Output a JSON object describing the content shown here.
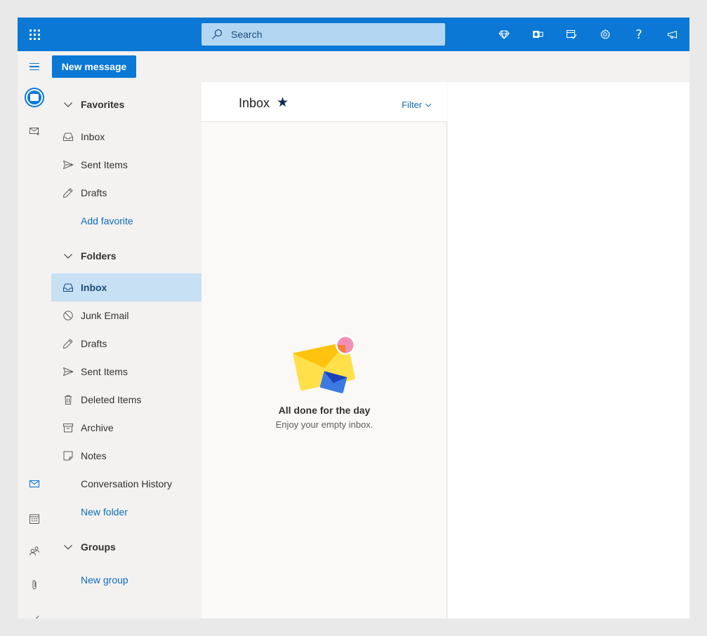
{
  "topbar": {
    "search_placeholder": "Search",
    "icons": [
      "diamond-icon",
      "office-icon",
      "calendar-check-icon",
      "gear-icon",
      "help-icon",
      "megaphone-icon"
    ],
    "help_glyph": "?"
  },
  "command": {
    "new_message": "New message"
  },
  "folders": {
    "favorites": {
      "label": "Favorites",
      "items": [
        "Inbox",
        "Sent Items",
        "Drafts"
      ],
      "add": "Add favorite"
    },
    "folders": {
      "label": "Folders",
      "items": [
        "Inbox",
        "Junk Email",
        "Drafts",
        "Sent Items",
        "Deleted Items",
        "Archive",
        "Notes",
        "Conversation History"
      ],
      "new": "New folder",
      "selected": "Inbox"
    },
    "groups": {
      "label": "Groups",
      "new": "New group"
    }
  },
  "list": {
    "title": "Inbox",
    "star": "★",
    "filter": "Filter",
    "empty_title": "All done for the day",
    "empty_subtitle": "Enjoy your empty inbox."
  },
  "colors": {
    "brand": "#0a78d4",
    "selected": "#c7e0f4",
    "link": "#0f6cbd"
  }
}
